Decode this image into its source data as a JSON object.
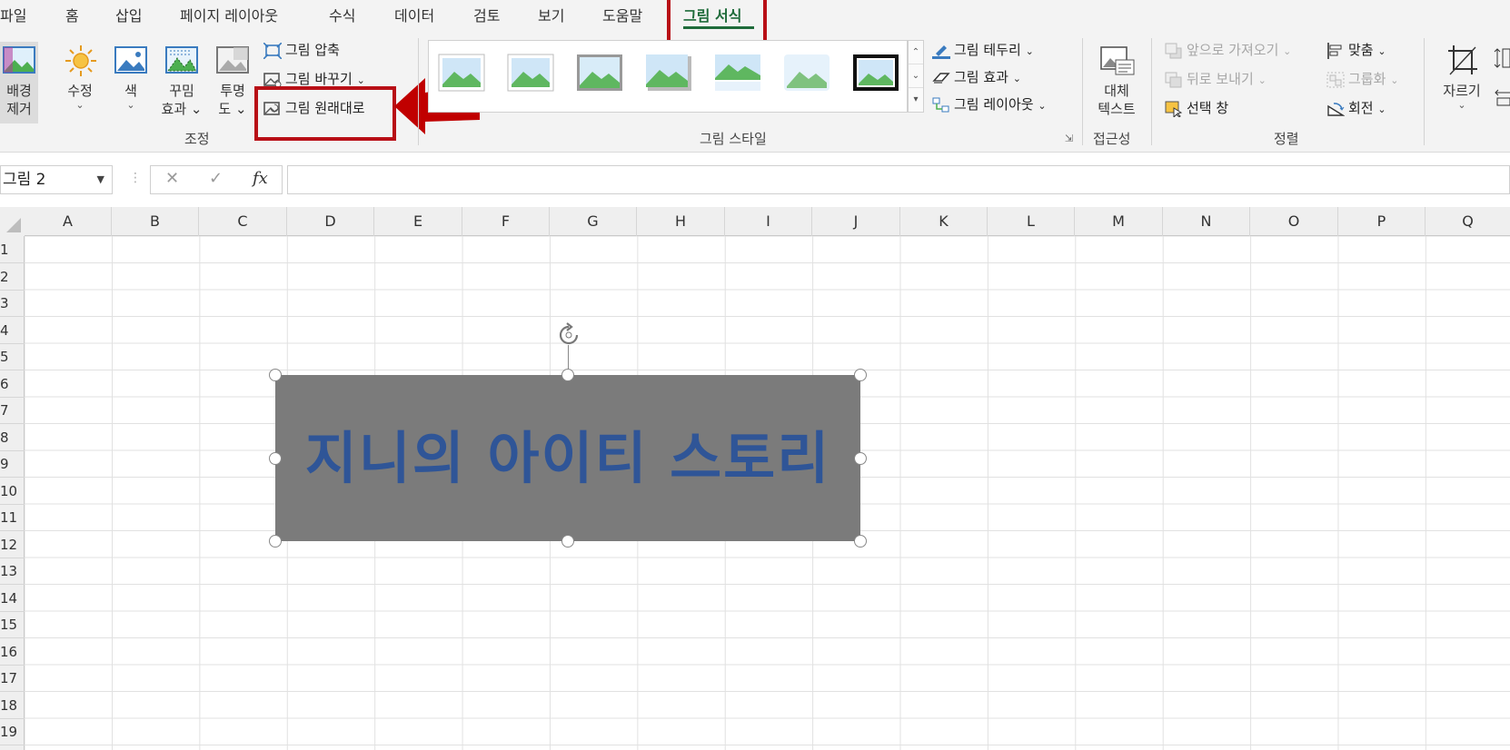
{
  "ribbon": {
    "tabs": [
      "파일",
      "홈",
      "삽입",
      "페이지 레이아웃",
      "수식",
      "데이터",
      "검토",
      "보기",
      "도움말",
      "그림 서식"
    ],
    "active_tab": "그림 서식",
    "groups": {
      "adjust": {
        "label": "조정",
        "remove_bg": [
          "배경",
          "제거"
        ],
        "corrections": "수정",
        "color": "색",
        "artistic": [
          "꾸밈",
          "효과"
        ],
        "transparency": [
          "투명",
          "도"
        ],
        "compress": "그림 압축",
        "change": "그림 바꾸기",
        "reset": "그림 원래대로"
      },
      "styles": {
        "label": "그림 스타일",
        "border": "그림 테두리",
        "effects": "그림 효과",
        "layout": "그림 레이아웃"
      },
      "access": {
        "label": "접근성",
        "alt_text": [
          "대체",
          "텍스트"
        ]
      },
      "arrange": {
        "label": "정렬",
        "bring_forward": "앞으로 가져오기",
        "send_backward": "뒤로 보내기",
        "selection_pane": "선택 창",
        "align": "맞춤",
        "group": "그룹화",
        "rotate": "회전"
      },
      "size": {
        "crop": "자르기"
      }
    }
  },
  "formula_bar": {
    "name_box": "그림 2",
    "cancel": "✕",
    "enter": "✓",
    "fx": "fx",
    "value": ""
  },
  "sheet": {
    "columns": [
      "A",
      "B",
      "C",
      "D",
      "E",
      "F",
      "G",
      "H",
      "I",
      "J",
      "K",
      "L",
      "M",
      "N",
      "O",
      "P",
      "Q"
    ],
    "rows": [
      "1",
      "2",
      "3",
      "4",
      "5",
      "6",
      "7",
      "8",
      "9",
      "10",
      "11",
      "12",
      "13",
      "14",
      "15",
      "16",
      "17",
      "18",
      "19"
    ],
    "picture_text": "지니의 아이티 스토리"
  },
  "colors": {
    "accent_green": "#1e6b3a",
    "highlight_red": "#b80f16",
    "picture_bg": "#7b7b7b",
    "picture_text": "#2f5597"
  }
}
